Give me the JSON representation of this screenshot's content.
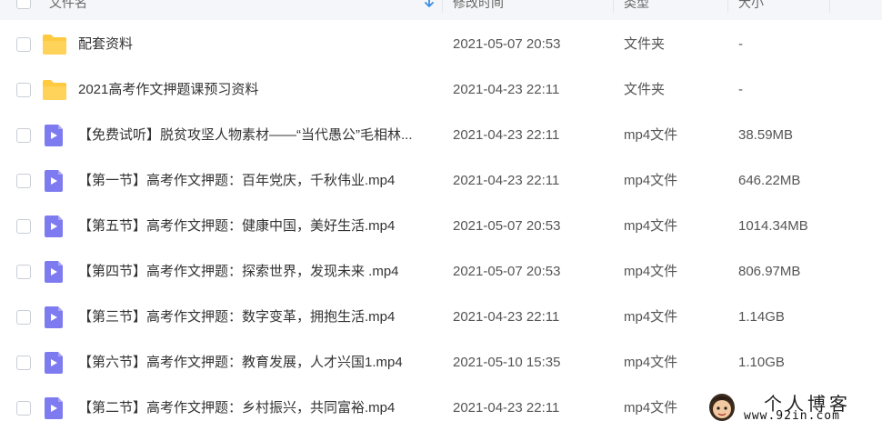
{
  "header": {
    "name_label": "文件名",
    "mtime_label": "修改时间",
    "type_label": "类型",
    "size_label": "大小"
  },
  "files": [
    {
      "name": "配套资料",
      "mtime": "2021-05-07 20:53",
      "type": "文件夹",
      "size": "-",
      "icon": "folder-icon"
    },
    {
      "name": "2021高考作文押题课预习资料",
      "mtime": "2021-04-23 22:11",
      "type": "文件夹",
      "size": "-",
      "icon": "folder-icon"
    },
    {
      "name": "【免费试听】脱贫攻坚人物素材——“当代愚公”毛相林...",
      "mtime": "2021-04-23 22:11",
      "type": "mp4文件",
      "size": "38.59MB",
      "icon": "video-file-icon"
    },
    {
      "name": "【第一节】高考作文押题：百年党庆，千秋伟业.mp4",
      "mtime": "2021-04-23 22:11",
      "type": "mp4文件",
      "size": "646.22MB",
      "icon": "video-file-icon"
    },
    {
      "name": "【第五节】高考作文押题：健康中国，美好生活.mp4",
      "mtime": "2021-05-07 20:53",
      "type": "mp4文件",
      "size": "1014.34MB",
      "icon": "video-file-icon"
    },
    {
      "name": "【第四节】高考作文押题：探索世界，发现未来 .mp4",
      "mtime": "2021-05-07 20:53",
      "type": "mp4文件",
      "size": "806.97MB",
      "icon": "video-file-icon"
    },
    {
      "name": "【第三节】高考作文押题：数字变革，拥抱生活.mp4",
      "mtime": "2021-04-23 22:11",
      "type": "mp4文件",
      "size": "1.14GB",
      "icon": "video-file-icon"
    },
    {
      "name": "【第六节】高考作文押题：教育发展，人才兴国1.mp4",
      "mtime": "2021-05-10 15:35",
      "type": "mp4文件",
      "size": "1.10GB",
      "icon": "video-file-icon"
    },
    {
      "name": "【第二节】高考作文押题：乡村振兴，共同富裕.mp4",
      "mtime": "2021-04-23 22:11",
      "type": "mp4文件",
      "size": "",
      "icon": "video-file-icon"
    }
  ],
  "watermark": {
    "title": "个人博客",
    "url": "www.92in.com"
  },
  "colors": {
    "folder": "#ffc940",
    "video": "#7e7bf0",
    "header_bg": "#f4f6f9",
    "sort_arrow": "#3a8ee6"
  }
}
